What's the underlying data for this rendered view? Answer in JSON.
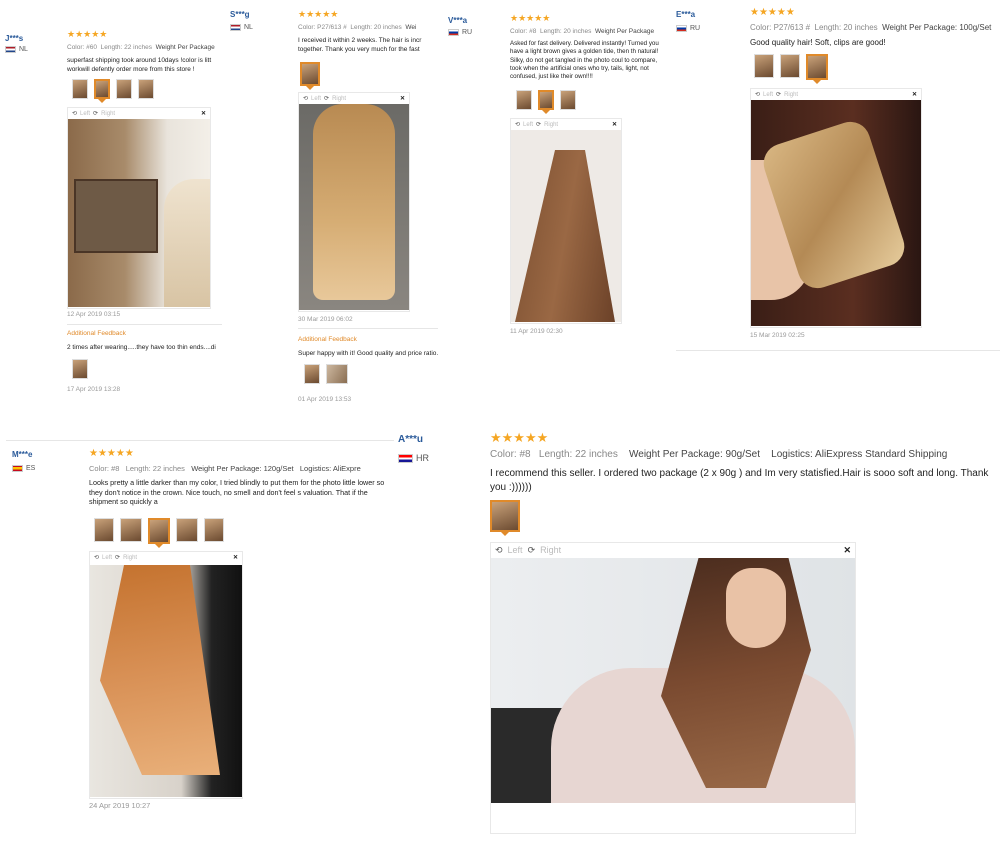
{
  "reviews": [
    {
      "user": "J***s",
      "country": "NL",
      "stars": "★★★★★",
      "color": "Color: #60",
      "length": "Length: 22 inches",
      "weight": "Weight Per Package",
      "text": "superfast shipping took around 10days !color is litt workwill defently order more from this store !",
      "viewer": {
        "left": "Left",
        "right": "Right"
      },
      "date": "12 Apr 2019 03:15",
      "additional_label": "Additional Feedback",
      "additional_text": "2 times after wearing.....they have too thin ends....di",
      "additional_date": "17 Apr 2019 13:28"
    },
    {
      "user": "S***g",
      "country": "NL",
      "stars": "★★★★★",
      "color": "Color: P27/613 #",
      "length": "Length: 20 inches",
      "weight": "Wei",
      "text": "I received it within 2 weeks. The hair is incr together. Thank you very much for the fast",
      "viewer": {
        "left": "Left",
        "right": "Right"
      },
      "date": "30 Mar 2019 06:02",
      "additional_label": "Additional Feedback",
      "additional_text": "Super happy with it! Good quality and price ratio.",
      "additional_date": "01 Apr 2019 13:53"
    },
    {
      "user": "V***a",
      "country": "RU",
      "stars": "★★★★★",
      "color": "Color: #8",
      "length": "Length: 20 inches",
      "weight": "Weight Per Package",
      "text": "Asked for fast delivery. Delivered instantly! Turned you have a light brown gives a golden tide, then th natural! Silky, do not get tangled in the photo coul to compare, took when the artificial ones who try, tails, light, not confused, just like their own!!!!",
      "viewer": {
        "left": "Left",
        "right": "Right"
      },
      "date": "11 Apr 2019 02:30"
    },
    {
      "user": "E***a",
      "country": "RU",
      "stars": "★★★★★",
      "color": "Color: P27/613 #",
      "length": "Length: 20 inches",
      "weight": "Weight Per Package: 100g/Set",
      "text": "Good quality hair! Soft, clips are good!",
      "viewer": {
        "left": "Left",
        "right": "Right"
      },
      "date": "15 Mar 2019 02:25"
    },
    {
      "user": "M***e",
      "country": "ES",
      "stars": "★★★★★",
      "color": "Color: #8",
      "length": "Length: 22 inches",
      "weight": "Weight Per Package: 120g/Set",
      "logistics": "Logistics: AliExpre",
      "text": "Looks pretty a little darker than my color, I tried blindly to put them for the photo little lower so they don't notice in the crown. Nice touch, no smell and don't feel s valuation. That if the shipment so quickly a",
      "viewer": {
        "left": "Left",
        "right": "Right"
      },
      "date": "24 Apr 2019 10:27"
    },
    {
      "user": "A***u",
      "country": "HR",
      "stars": "★★★★★",
      "color": "Color: #8",
      "length": "Length: 22 inches",
      "weight": "Weight Per Package: 90g/Set",
      "logistics": "Logistics: AliExpress Standard Shipping",
      "text": "I recommend this seller. I ordered two package (2 x 90g ) and Im very statisfied.Hair is sooo soft and long. Thank you :))))))",
      "viewer": {
        "left": "Left",
        "right": "Right"
      }
    }
  ],
  "colors": {
    "star": "#f5a623",
    "accent": "#e08a2a",
    "user": "#2a5a9a"
  }
}
